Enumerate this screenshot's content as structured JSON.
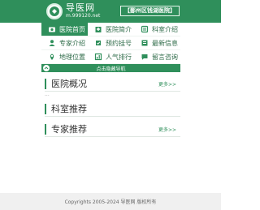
{
  "header": {
    "logo_title": "导医网",
    "logo_url": "m.999120.net",
    "region": "【鄞州区钱湖医院】"
  },
  "nav": [
    {
      "label": "医院首页",
      "icon": "camera-icon",
      "active": true
    },
    {
      "label": "医院简介",
      "icon": "hospital-icon",
      "active": false
    },
    {
      "label": "科室介绍",
      "icon": "department-icon",
      "active": false
    },
    {
      "label": "专家介绍",
      "icon": "doctor-icon",
      "active": false
    },
    {
      "label": "预约挂号",
      "icon": "appointment-icon",
      "active": false
    },
    {
      "label": "最新信息",
      "icon": "news-icon",
      "active": false
    },
    {
      "label": "地理位置",
      "icon": "location-icon",
      "active": false
    },
    {
      "label": "人气排行",
      "icon": "ranking-icon",
      "active": false
    },
    {
      "label": "留言咨询",
      "icon": "message-icon",
      "active": false
    }
  ],
  "toggle_label": "点击隐藏导航",
  "sections": {
    "overview": {
      "title": "医院概况",
      "more": "更多>>",
      "dots": "..."
    },
    "departments": {
      "title": "科室推荐"
    },
    "experts": {
      "title": "专家推荐",
      "more": "更多>>"
    }
  },
  "footer": "Copyrights 2005-2024 导医网 版权所有",
  "colors": {
    "primary": "#2f8f5b",
    "footer_bg": "#f0f0f0"
  }
}
